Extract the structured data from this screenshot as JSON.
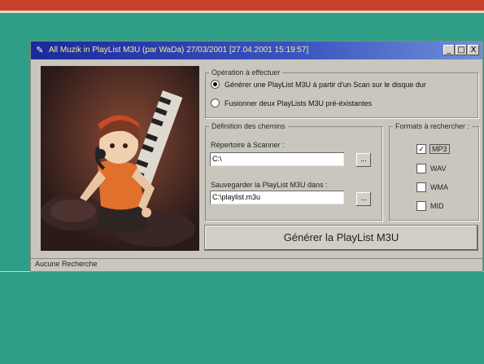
{
  "window": {
    "title": "All Muzik in PlayList M3U (par WaDa) 27/03/2001   [27.04.2001   15:19:57]",
    "min_btn": "_",
    "max_btn": "□",
    "close_btn": "X"
  },
  "operation": {
    "group_label": "Opération à effectuer",
    "options": [
      {
        "label": "Générer une PlayList M3U à partir d'un Scan sur le disque dur",
        "selected": true
      },
      {
        "label": "Fusionner deux PlayLists M3U pré-éxistantes",
        "selected": false
      }
    ]
  },
  "paths": {
    "group_label": "Définition des chemins",
    "scan_label": "Répertoire à Scanner :",
    "scan_value": "C:\\",
    "save_label": "Sauvegarder la PlayList M3U dans :",
    "save_value": "C:\\playlist.m3u",
    "browse_label": "..."
  },
  "formats": {
    "group_label": "Formats à rechercher :",
    "items": [
      {
        "label": "MP3",
        "checked": true
      },
      {
        "label": "WAV",
        "checked": false
      },
      {
        "label": "WMA",
        "checked": false
      },
      {
        "label": "MID",
        "checked": false
      }
    ],
    "check_glyph": "✓"
  },
  "generate_button": "Générer la PlayList M3U",
  "status": "Aucune Recherche",
  "colors": {
    "page_background": "#2e9e86",
    "title_gradient_start": "#1a2a9a",
    "title_text": "#f2e9a8",
    "window_face": "#c9c7bd"
  }
}
